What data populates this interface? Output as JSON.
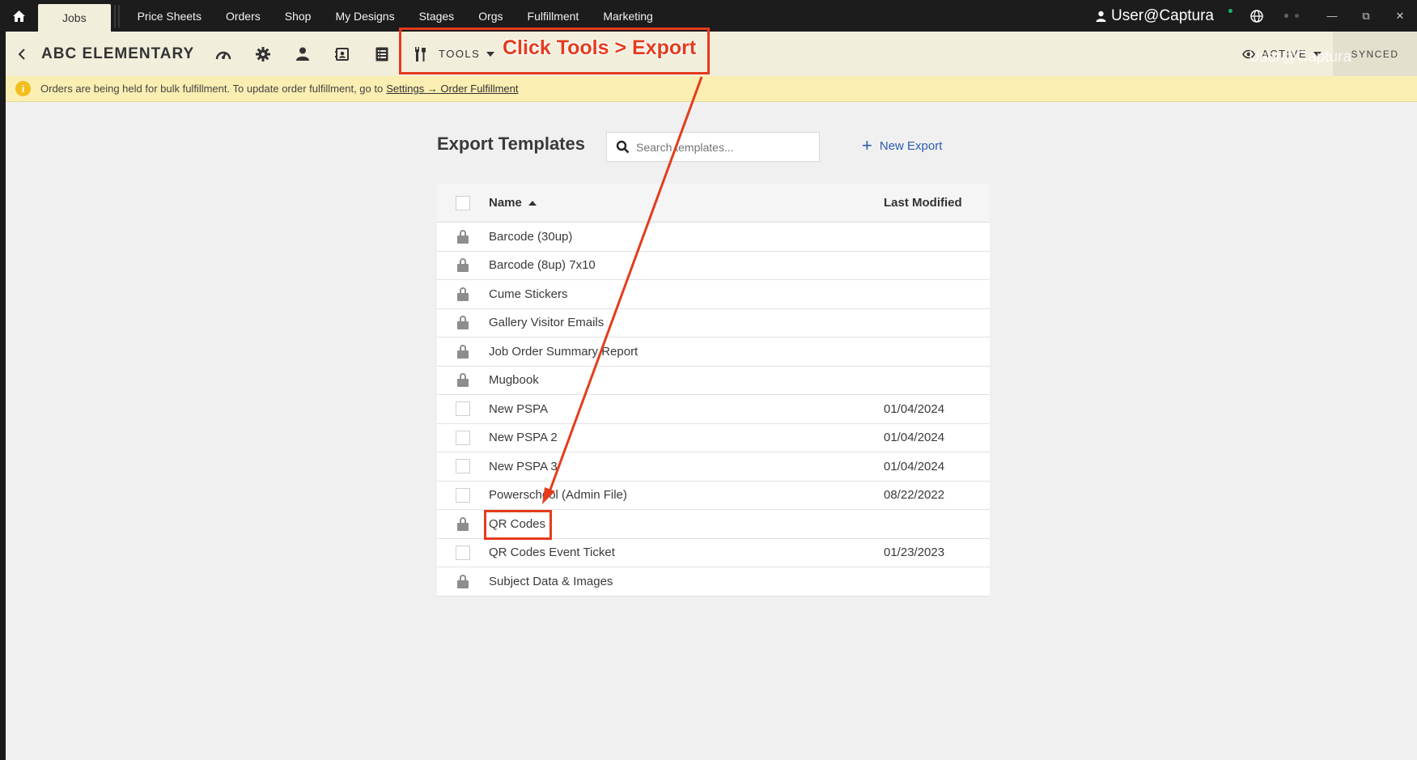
{
  "topnav": {
    "tabs": [
      "Jobs",
      "Price Sheets",
      "Orders",
      "Shop",
      "My Designs",
      "Stages",
      "Orgs",
      "Fulfillment",
      "Marketing"
    ],
    "user": "User@Captura"
  },
  "jobbar": {
    "title": "ABC ELEMENTARY",
    "tools_label": "TOOLS",
    "status_label": "ACTIVE",
    "watermark": "User@Captura",
    "synced_label": "SYNCED"
  },
  "annotation": {
    "text": "Click Tools > Export",
    "color": "#e43c1c"
  },
  "banner": {
    "text": "Orders are being held for bulk fulfillment. To update order fulfillment, go to",
    "link": "Settings → Order Fulfillment"
  },
  "panel": {
    "title": "Export Templates",
    "search_placeholder": "Search templates...",
    "new_export_label": "New Export"
  },
  "table": {
    "columns": [
      "Name",
      "Last Modified"
    ],
    "rows": [
      {
        "name": "Barcode (30up)",
        "date": "",
        "locked": true
      },
      {
        "name": "Barcode (8up) 7x10",
        "date": "",
        "locked": true
      },
      {
        "name": "Cume Stickers",
        "date": "",
        "locked": true
      },
      {
        "name": "Gallery Visitor Emails",
        "date": "",
        "locked": true
      },
      {
        "name": "Job Order Summary Report",
        "date": "",
        "locked": true
      },
      {
        "name": "Mugbook",
        "date": "",
        "locked": true
      },
      {
        "name": "New PSPA",
        "date": "01/04/2024",
        "locked": false
      },
      {
        "name": "New PSPA 2",
        "date": "01/04/2024",
        "locked": false
      },
      {
        "name": "New PSPA 3",
        "date": "01/04/2024",
        "locked": false
      },
      {
        "name": "Powerschool (Admin File)",
        "date": "08/22/2022",
        "locked": false
      },
      {
        "name": "QR Codes",
        "date": "",
        "locked": true
      },
      {
        "name": "QR Codes Event Ticket",
        "date": "01/23/2023",
        "locked": false
      },
      {
        "name": "Subject Data & Images",
        "date": "",
        "locked": true
      }
    ]
  },
  "colors": {
    "accent_link": "#2a5db0",
    "banner_bg": "#fbeeb2",
    "jobbar_bg": "#f2eedc"
  }
}
